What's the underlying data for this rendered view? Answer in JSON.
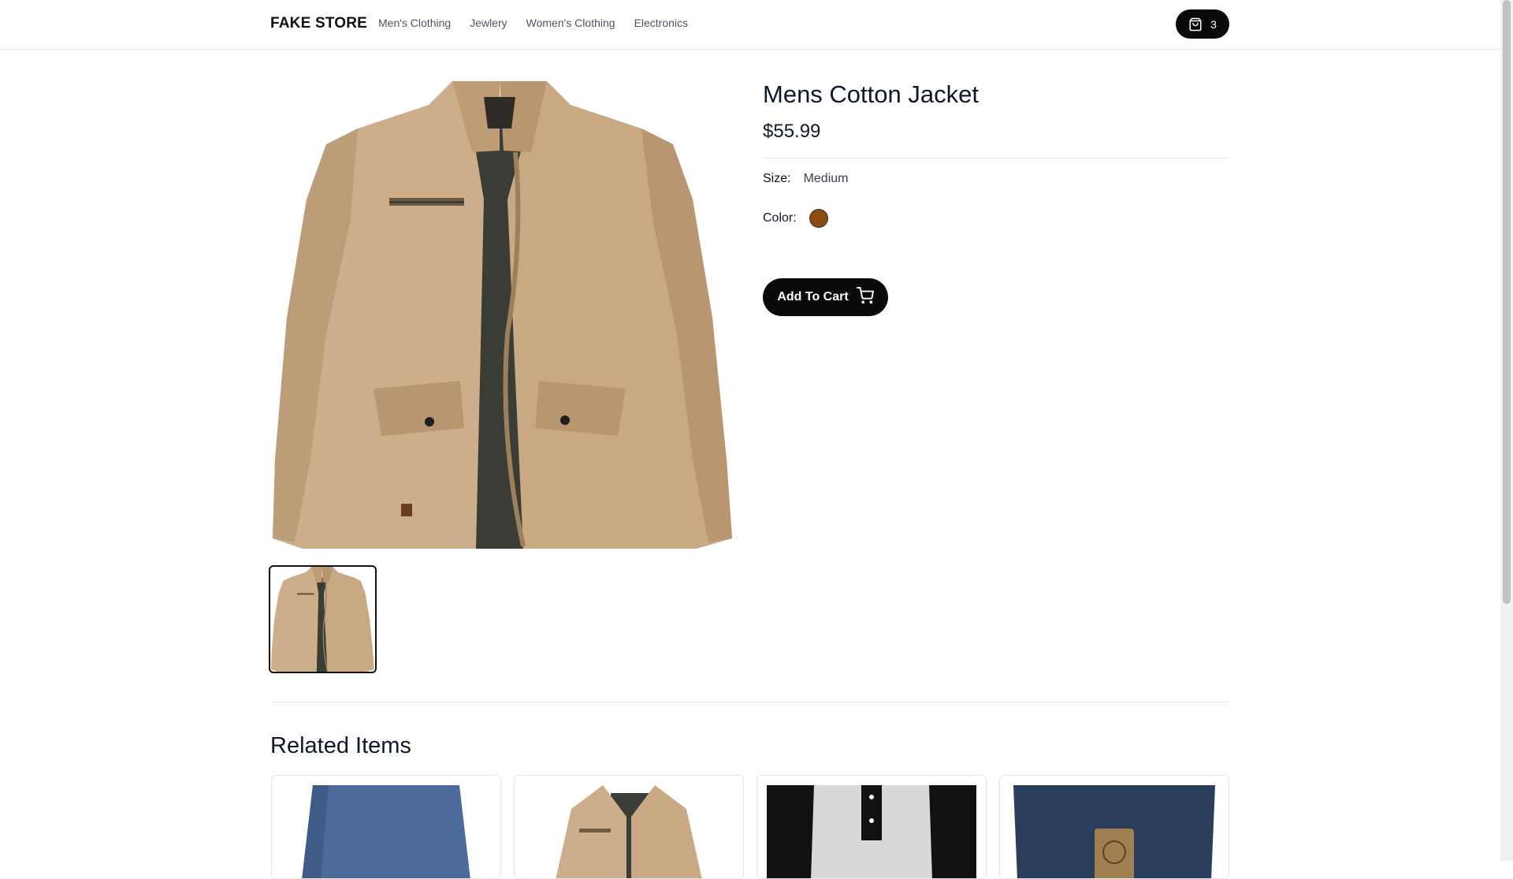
{
  "header": {
    "logo": "FAKE STORE",
    "nav": [
      "Men's Clothing",
      "Jewlery",
      "Women's Clothing",
      "Electronics"
    ],
    "cart_count": "3"
  },
  "product": {
    "title": "Mens Cotton Jacket",
    "price": "$55.99",
    "size_label": "Size:",
    "size_value": "Medium",
    "color_label": "Color:",
    "color_hex": "#8B4A0E",
    "add_to_cart": "Add To Cart"
  },
  "related": {
    "title": "Related Items",
    "items": [
      {
        "image": "blue-shirt-image"
      },
      {
        "image": "cotton-jacket-image"
      },
      {
        "image": "raglan-tee-image"
      },
      {
        "image": "backpack-image"
      }
    ]
  },
  "colors": {
    "accent": "#0a0a0a",
    "jacket": "#cdae8a",
    "lining": "#3a3d36"
  }
}
